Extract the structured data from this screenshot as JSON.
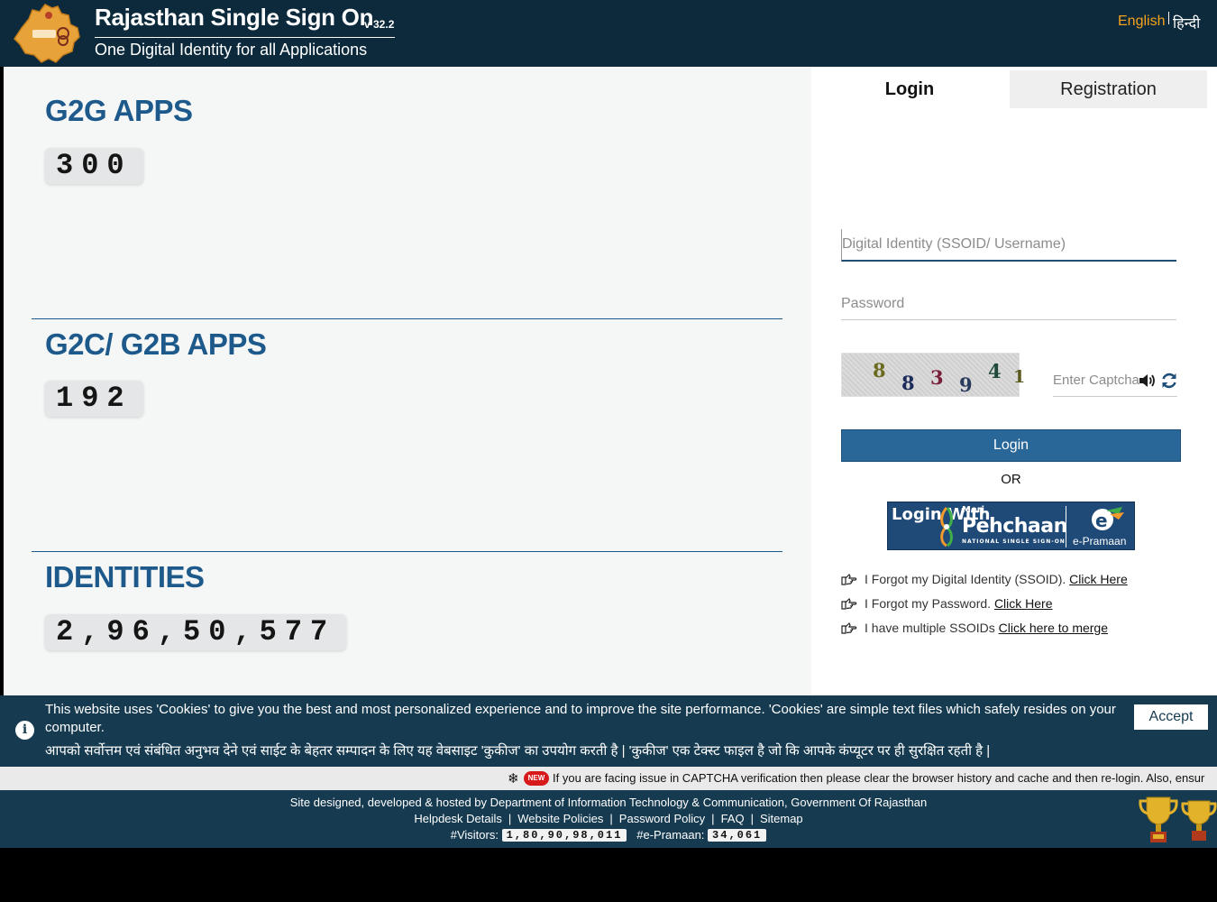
{
  "header": {
    "title": "Rajasthan Single Sign On",
    "version": "v 32.2",
    "subtitle": "One Digital Identity for all Applications",
    "lang_english": "English",
    "lang_hindi": "हिन्दी"
  },
  "stats": [
    {
      "title": "G2G APPS",
      "value": "300"
    },
    {
      "title": "G2C/ G2B APPS",
      "value": "192"
    },
    {
      "title": "IDENTITIES",
      "value": "2,96,50,577"
    }
  ],
  "login": {
    "tab_login": "Login",
    "tab_registration": "Registration",
    "ssoid_placeholder": "Digital Identity (SSOID/ Username)",
    "password_placeholder": "Password",
    "captcha_digits": [
      "8",
      "8",
      "3",
      "9",
      "4",
      "1"
    ],
    "captcha_placeholder": "Enter Captcha",
    "login_button": "Login",
    "or_label": "OR",
    "epramaan": {
      "login_with": "Login With",
      "meri": "Meri",
      "pehchaan": "Pehchaan",
      "tagline": "NATIONAL SINGLE SIGN-ON",
      "brand": "e-Pramaan"
    },
    "help": [
      {
        "text": "I Forgot my Digital Identity (SSOID). ",
        "link": "Click Here"
      },
      {
        "text": "I Forgot my Password. ",
        "link": "Click Here"
      },
      {
        "text": "I have multiple SSOIDs ",
        "link": "Click here to merge"
      }
    ]
  },
  "cookie": {
    "english": "This website uses 'Cookies' to give you the best and most personalized experience and to improve the site performance. 'Cookies' are simple text files which safely resides on your computer.",
    "hindi": "आपको सर्वोत्तम एवं संबंधित अनुभव देने एवं साईट के बेहतर सम्पादन के लिए यह वेबसाइट 'कुकीज' का उपयोग करती है | 'कुकीज' एक टेक्स्ट फाइल है जो कि आपके कंप्यूटर पर ही सुरक्षित रहती है |",
    "accept": "Accept"
  },
  "ticker": {
    "badge": "NEW",
    "text": "If you are facing issue in CAPTCHA verification then please clear the browser history and cache and then re-login. Also, ensur"
  },
  "footer": {
    "credit": "Site designed, developed & hosted by Department of Information Technology & Communication, Government Of Rajasthan",
    "links": [
      "Helpdesk Details",
      "Website Policies",
      "Password Policy",
      "FAQ",
      "Sitemap"
    ],
    "visitors_label": "#Visitors:",
    "visitors_value": "1,80,90,98,011",
    "epramaan_label": "#e-Pramaan:",
    "epramaan_value": "34,061"
  },
  "colors": {
    "header_bg": "#0c2a3c",
    "accent_blue": "#1d5a8b",
    "login_button": "#2a6799",
    "lang_active": "#f7a21b",
    "banner_bg": "#163a50"
  }
}
